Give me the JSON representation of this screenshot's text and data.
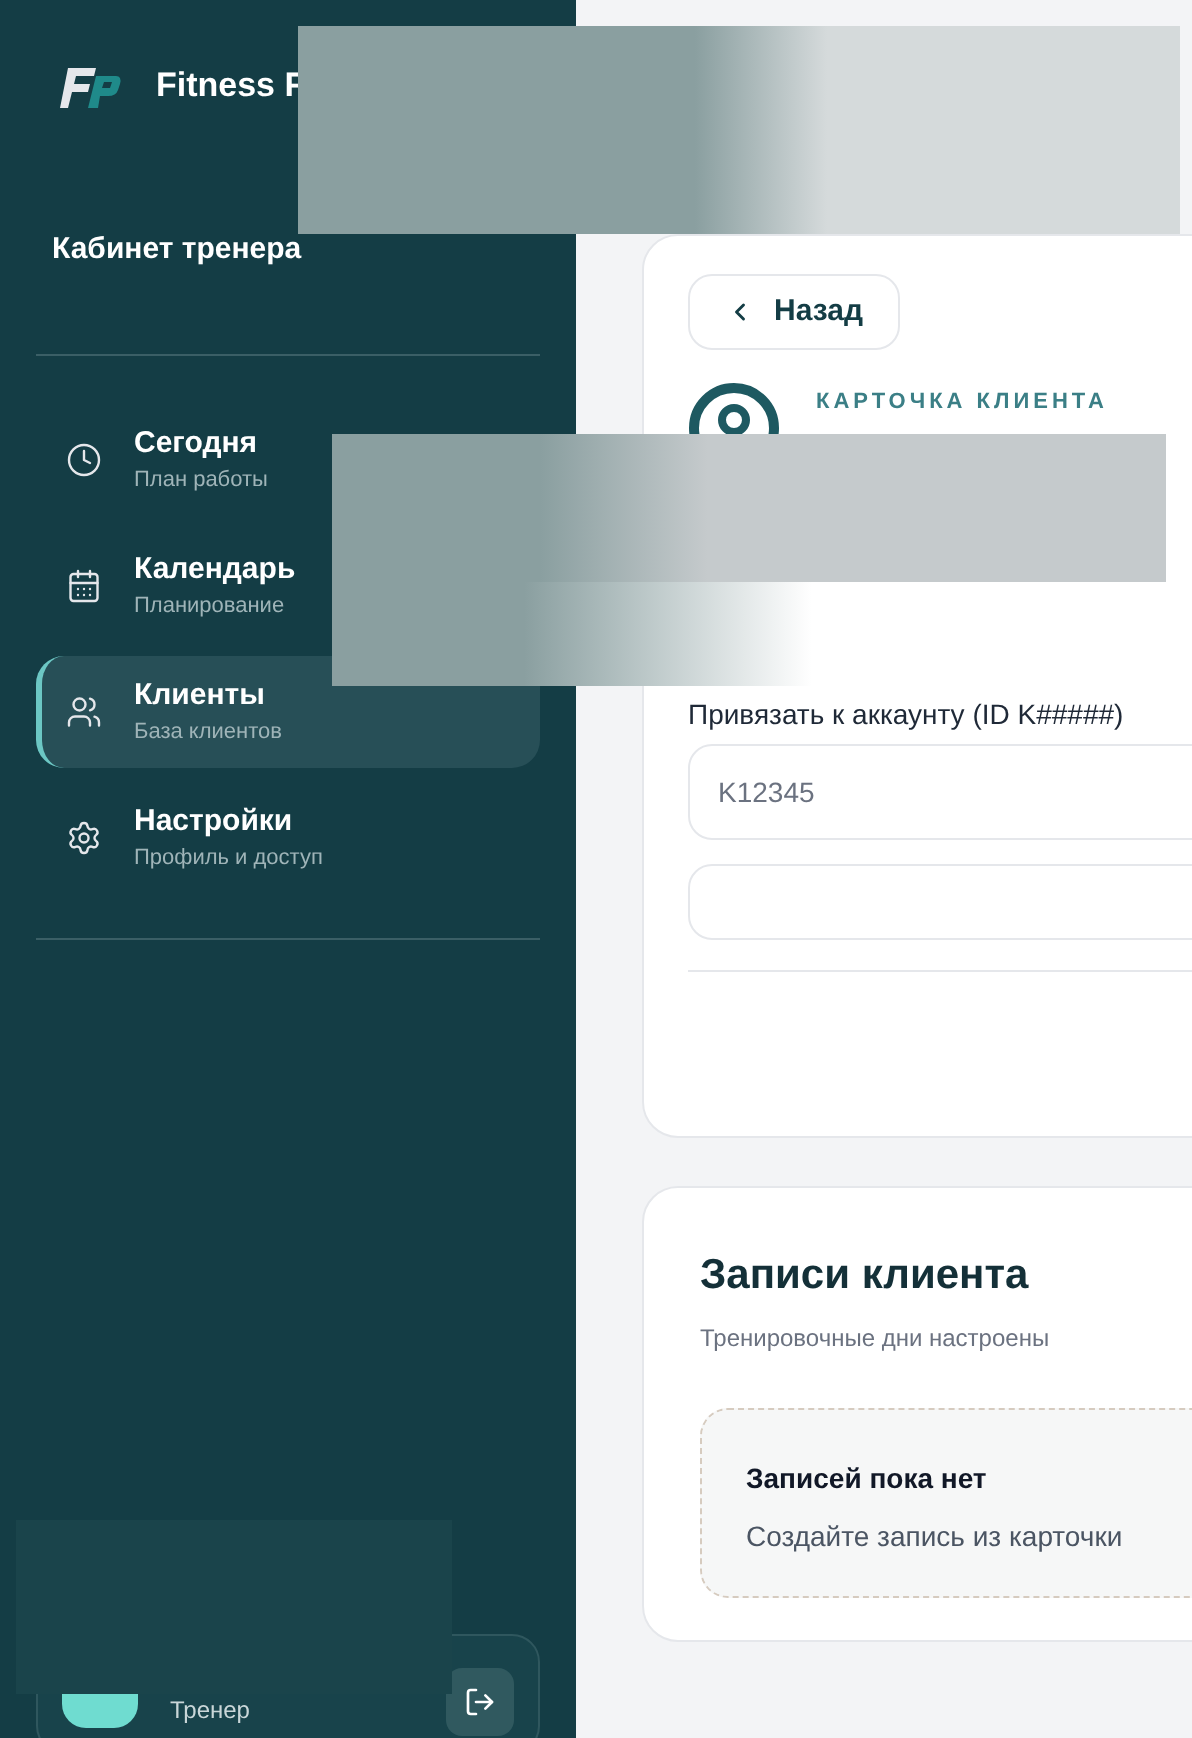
{
  "brand": {
    "name": "Fitness F"
  },
  "sidebar": {
    "title": "Кабинет тренера",
    "items": [
      {
        "kind": "clock",
        "label": "Сегодня",
        "sublabel": "План работы",
        "selected": false
      },
      {
        "kind": "calendar",
        "label": "Календарь",
        "sublabel": "Планирование",
        "selected": false
      },
      {
        "kind": "users",
        "label": "Клиенты",
        "sublabel": "База клиентов",
        "selected": true
      },
      {
        "kind": "settings",
        "label": "Настройки",
        "sublabel": "Профиль и доступ",
        "selected": false
      }
    ],
    "user": {
      "role": "Тренер"
    }
  },
  "client_card": {
    "back": "Назад",
    "eyebrow": "КАРТОЧКА КЛИЕНТА",
    "account_label": "Привязать к аккаунту (ID K#####)",
    "account_field": {
      "placeholder": "K12345"
    }
  },
  "records": {
    "title": "Записи клиента",
    "subtitle": "Тренировочные дни настроены",
    "empty": {
      "title": "Записей пока нет",
      "text": "Создайте запись из карточки"
    }
  }
}
